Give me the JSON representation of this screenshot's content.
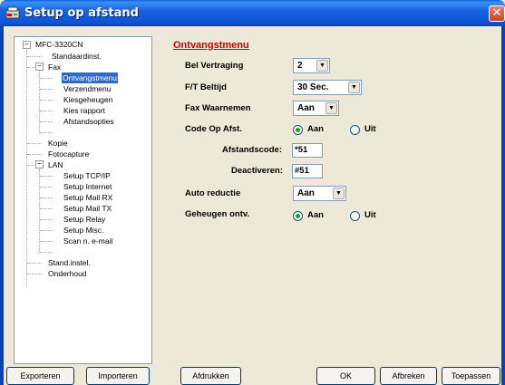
{
  "window": {
    "title": "Setup op afstand",
    "close_label": "✕"
  },
  "tree": {
    "root": "MFC-3320CN",
    "nodes": [
      {
        "label": "Standaardinst.",
        "level": 2
      },
      {
        "label": "Fax",
        "level": 1
      },
      {
        "label": "Ontvangstmenu",
        "level": 2,
        "selected": true
      },
      {
        "label": "Verzendmenu",
        "level": 2
      },
      {
        "label": "Kiesgeheugen",
        "level": 2
      },
      {
        "label": "Kies rapport",
        "level": 2
      },
      {
        "label": "Afstandsopties",
        "level": 2
      },
      {
        "label": "Kopie",
        "level": 1
      },
      {
        "label": "Fotocapture",
        "level": 1
      },
      {
        "label": "LAN",
        "level": 1
      },
      {
        "label": "Setup TCP/IP",
        "level": 2
      },
      {
        "label": "Setup Internet",
        "level": 2
      },
      {
        "label": "Setup Mail RX",
        "level": 2
      },
      {
        "label": "Setup Mail TX",
        "level": 2
      },
      {
        "label": "Setup Relay",
        "level": 2
      },
      {
        "label": "Setup Misc.",
        "level": 2
      },
      {
        "label": "Scan n. e-mail",
        "level": 2
      },
      {
        "label": "Stand.instel.",
        "level": 1
      },
      {
        "label": "Onderhoud",
        "level": 1
      }
    ]
  },
  "panel": {
    "title": "Ontvangstmenu",
    "bel_vertraging": {
      "label": "Bel Vertraging",
      "value": "2"
    },
    "ft_beltijd": {
      "label": "F/T Beltijd",
      "value": "30 Sec."
    },
    "fax_waarnemen": {
      "label": "Fax Waarnemen",
      "value": "Aan"
    },
    "code_op_afst": {
      "label": "Code Op Afst.",
      "on": "Aan",
      "off": "Uit",
      "selected": "Aan"
    },
    "afstandscode": {
      "label": "Afstandscode:",
      "value": "*51"
    },
    "deactiveren": {
      "label": "Deactiveren:",
      "value": "#51"
    },
    "auto_reductie": {
      "label": "Auto reductie",
      "value": "Aan"
    },
    "geheugen_ontv": {
      "label": "Geheugen ontv.",
      "on": "Aan",
      "off": "Uit",
      "selected": "Aan"
    }
  },
  "buttons": {
    "exporteren": "Exporteren",
    "importeren": "Importeren",
    "afdrukken": "Afdrukken",
    "ok": "OK",
    "afbreken": "Afbreken",
    "toepassen": "Toepassen"
  },
  "colors": {
    "titlebar": "#0d54d6",
    "section_title": "#cc0000",
    "selection": "#316ac5",
    "window_bg": "#ece9d8"
  }
}
